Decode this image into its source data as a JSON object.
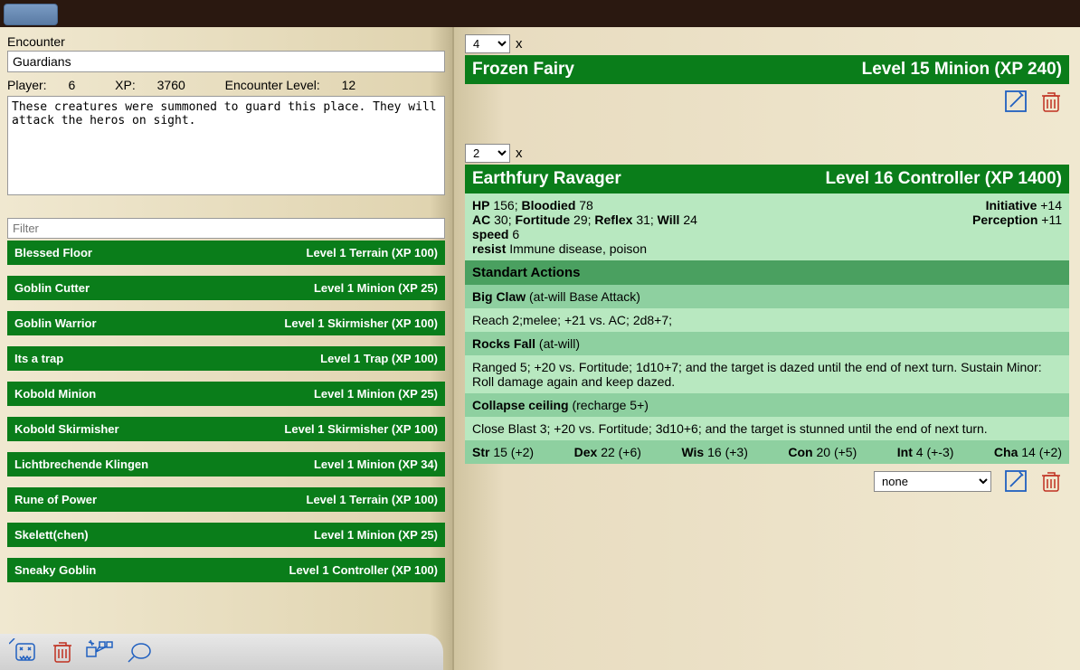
{
  "encounter": {
    "label": "Encounter",
    "name": "Guardians",
    "player_label": "Player:",
    "player": "6",
    "xp_label": "XP:",
    "xp": "3760",
    "level_label": "Encounter Level:",
    "level": "12",
    "notes": "These creatures were summoned to guard this place. They will attack the heros on sight."
  },
  "filter": {
    "placeholder": "Filter"
  },
  "monsters": [
    {
      "name": "Blessed Floor",
      "meta": "Level 1 Terrain (XP 100)"
    },
    {
      "name": "Goblin Cutter",
      "meta": "Level 1 Minion (XP 25)"
    },
    {
      "name": "Goblin Warrior",
      "meta": "Level 1 Skirmisher (XP 100)"
    },
    {
      "name": "Its a trap",
      "meta": "Level 1 Trap (XP 100)"
    },
    {
      "name": "Kobold Minion",
      "meta": "Level 1 Minion (XP 25)"
    },
    {
      "name": "Kobold Skirmisher",
      "meta": "Level 1 Skirmisher (XP 100)"
    },
    {
      "name": "Lichtbrechende Klingen",
      "meta": "Level 1 Minion (XP 34)"
    },
    {
      "name": "Rune of Power",
      "meta": "Level 1 Terrain (XP 100)"
    },
    {
      "name": "Skelett(chen)",
      "meta": "Level 1 Minion (XP 25)"
    },
    {
      "name": "Sneaky Goblin",
      "meta": "Level 1 Controller (XP 100)"
    }
  ],
  "c1": {
    "qty": "4",
    "x": "x",
    "name": "Frozen Fairy",
    "meta": "Level 15 Minion (XP 240)"
  },
  "c2": {
    "qty": "2",
    "x": "x",
    "name": "Earthfury Ravager",
    "meta": "Level 16 Controller (XP 1400)",
    "hp_l": "HP",
    "hp": "156;",
    "bloodied_l": "Bloodied",
    "bloodied": "78",
    "init_l": "Initiative",
    "init": "+14",
    "ac_l": "AC",
    "ac": "30;",
    "fort_l": "Fortitude",
    "fort": "29;",
    "ref_l": "Reflex",
    "ref": "31;",
    "will_l": "Will",
    "will": "24",
    "perc_l": "Perception",
    "perc": "+11",
    "speed_l": "speed",
    "speed": "6",
    "resist_l": "resist",
    "resist": "Immune disease, poison",
    "std_actions": "Standart Actions",
    "a1_name": "Big Claw",
    "a1_type": "(at-will Base Attack)",
    "a1_desc": "Reach 2;melee; +21 vs. AC; 2d8+7;",
    "a2_name": "Rocks Fall",
    "a2_type": "(at-will)",
    "a2_desc": "Ranged 5; +20 vs. Fortitude; 1d10+7; and the target is dazed until the end of next turn. Sustain Minor: Roll damage again and keep dazed.",
    "a3_name": "Collapse ceiling",
    "a3_type": "(recharge 5+)",
    "a3_desc": "Close Blast 3; +20 vs. Fortitude; 3d10+6; and the target is stunned until the end of next turn.",
    "str_l": "Str",
    "str": "15 (+2)",
    "dex_l": "Dex",
    "dex": "22 (+6)",
    "wis_l": "Wis",
    "wis": "16 (+3)",
    "con_l": "Con",
    "con": "20 (+5)",
    "int_l": "Int",
    "int": "4 (+-3)",
    "cha_l": "Cha",
    "cha": "14 (+2)",
    "theme": "none"
  },
  "colors": {
    "green_dark": "#0a7d1a",
    "green_mid": "#4aa060",
    "green_light": "#8ed0a0",
    "green_pale": "#b8e8c0"
  }
}
